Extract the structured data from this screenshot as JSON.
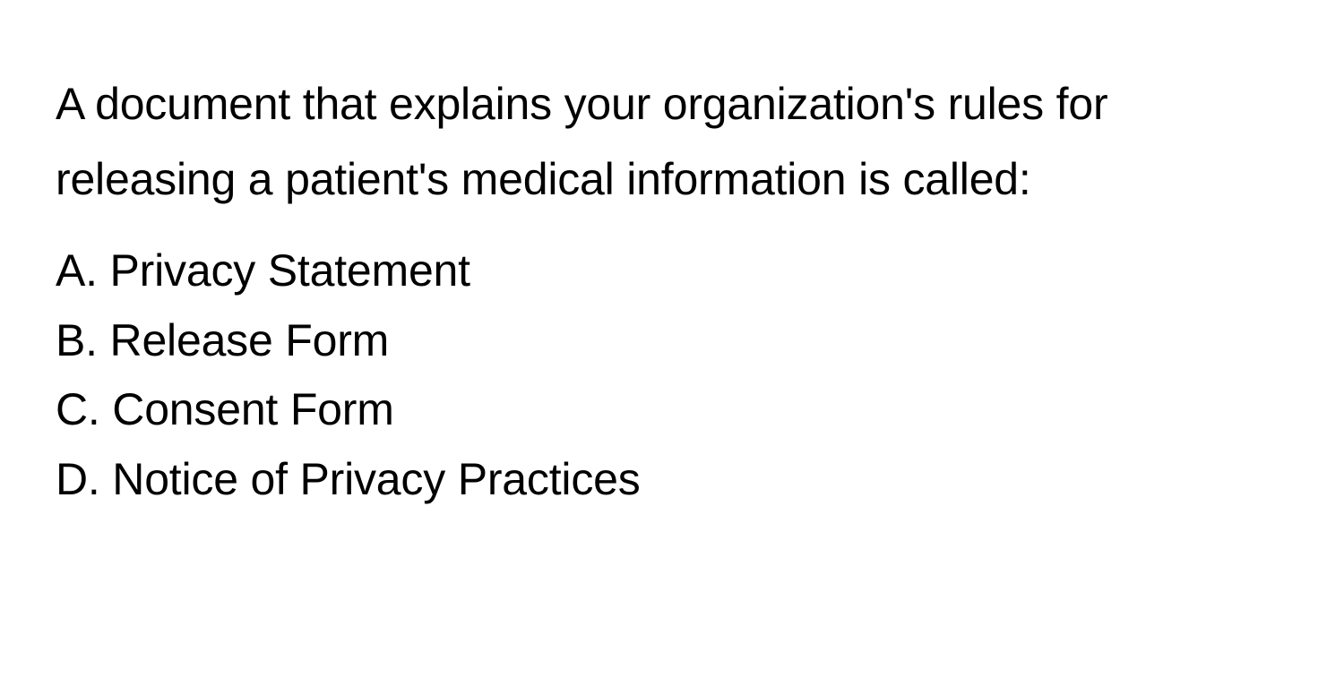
{
  "question": "A document that explains your organization's rules for releasing a patient's medical information is called:",
  "options": {
    "a": "A. Privacy Statement",
    "b": "B. Release Form",
    "c": "C. Consent Form",
    "d": "D. Notice of Privacy Practices"
  }
}
